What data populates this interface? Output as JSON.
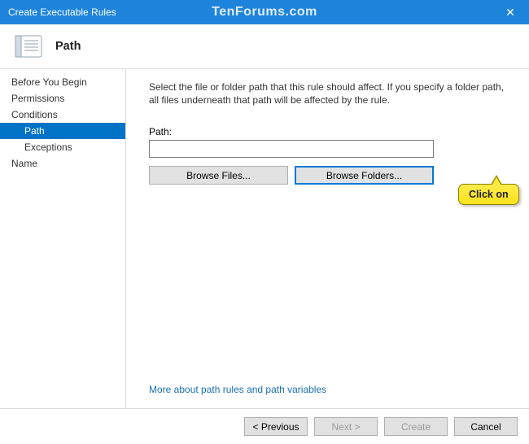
{
  "titlebar": {
    "title": "Create Executable Rules",
    "watermark": "TenForums.com"
  },
  "header": {
    "page_title": "Path"
  },
  "sidebar": {
    "items": [
      {
        "label": "Before You Begin",
        "sub": false,
        "selected": false
      },
      {
        "label": "Permissions",
        "sub": false,
        "selected": false
      },
      {
        "label": "Conditions",
        "sub": false,
        "selected": false
      },
      {
        "label": "Path",
        "sub": true,
        "selected": true
      },
      {
        "label": "Exceptions",
        "sub": true,
        "selected": false
      },
      {
        "label": "Name",
        "sub": false,
        "selected": false
      }
    ]
  },
  "content": {
    "description": "Select the file or folder path that this rule should affect. If you specify a folder path, all files underneath that path will be affected by the rule.",
    "path_label": "Path:",
    "path_value": "",
    "browse_files": "Browse Files...",
    "browse_folders": "Browse Folders...",
    "callout": "Click on",
    "more_link": "More about path rules and path variables"
  },
  "footer": {
    "previous": "< Previous",
    "next": "Next >",
    "create": "Create",
    "cancel": "Cancel"
  }
}
